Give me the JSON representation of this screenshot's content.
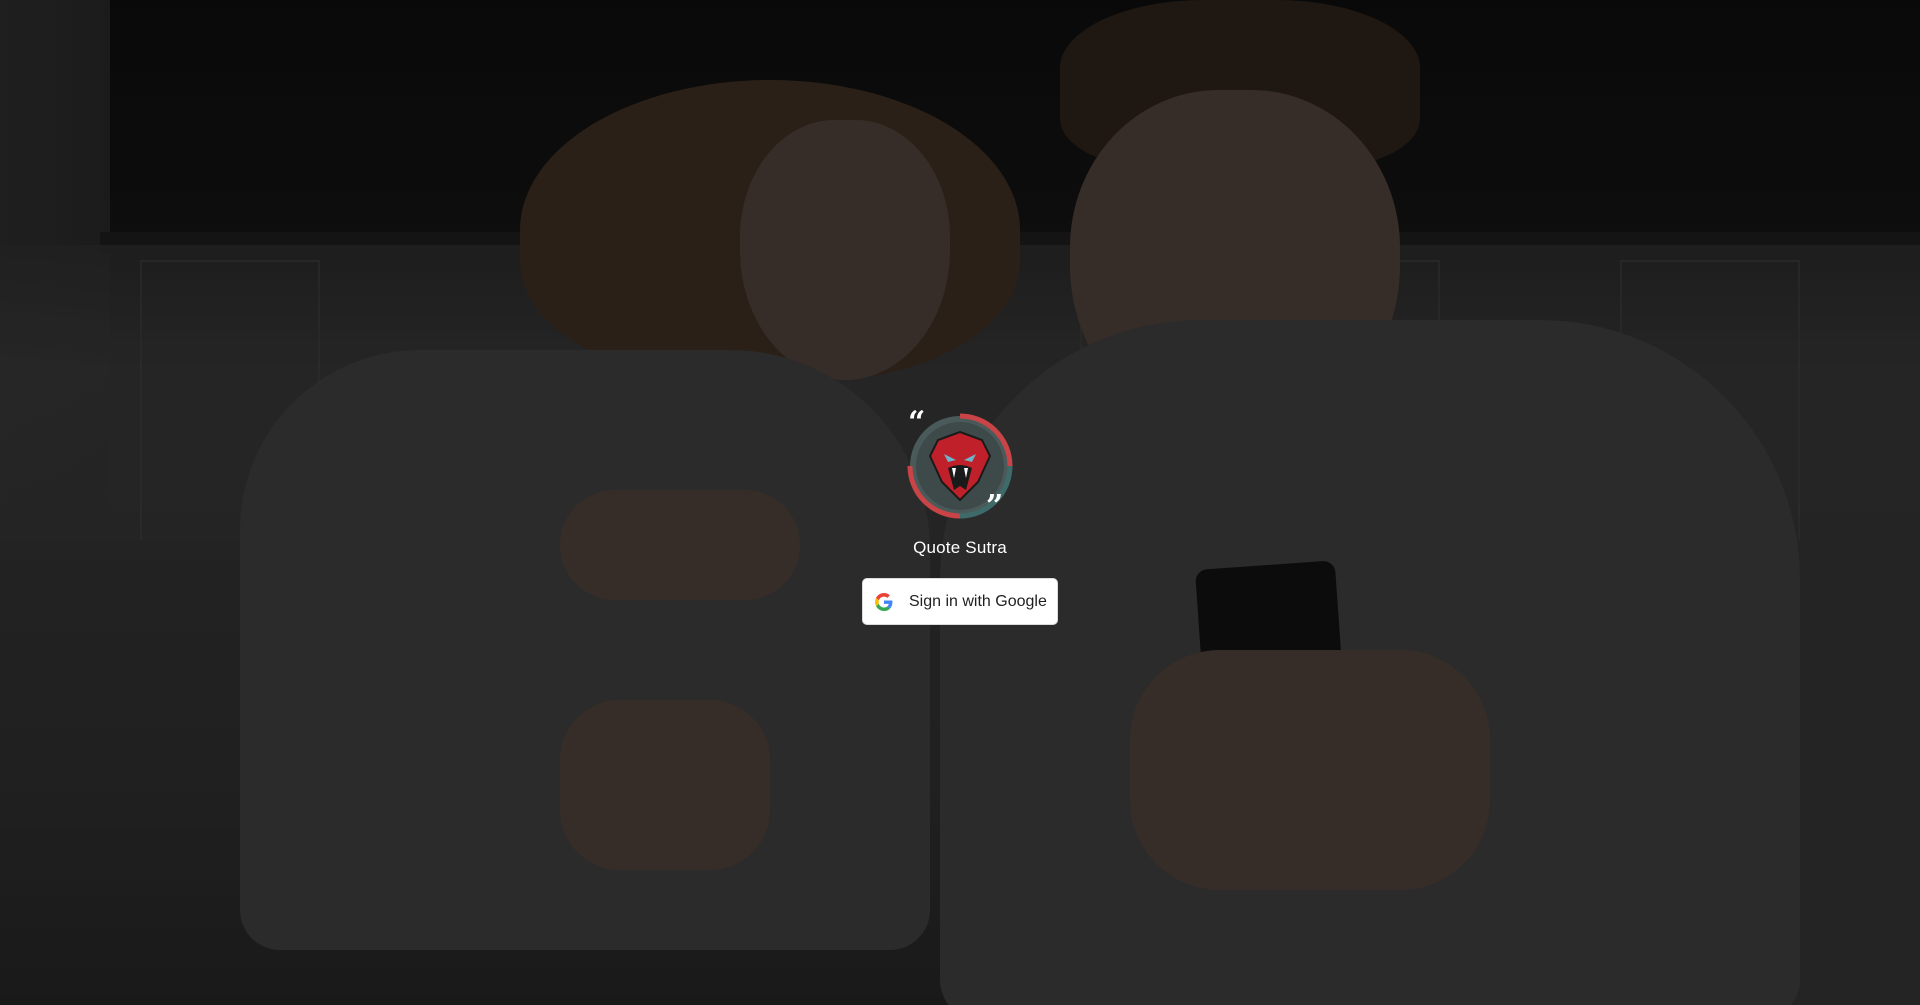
{
  "app": {
    "name": "Quote Sutra"
  },
  "signin": {
    "label": "Sign in with Google",
    "icon": "google-g-icon"
  },
  "logo": {
    "icon": "cobra-quote-logo",
    "ring_colors": [
      "#c94446",
      "#3e6b6a"
    ],
    "snake_color": "#c0202a"
  },
  "background": {
    "description_icon": "couple-with-phones-photo"
  }
}
